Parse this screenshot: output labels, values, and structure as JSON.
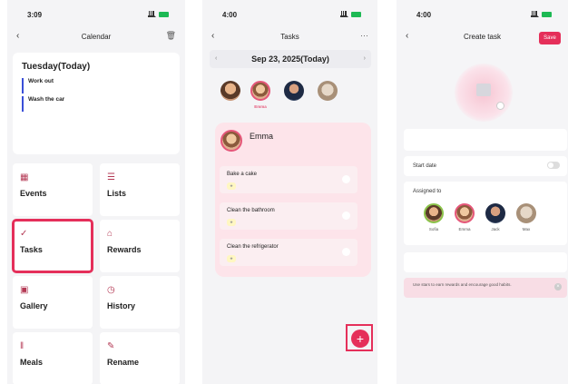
{
  "screen1": {
    "status_time": "3:09",
    "nav_title": "Calendar",
    "today_header": "Tuesday(Today)",
    "events": [
      {
        "title": "Work out"
      },
      {
        "title": "Wash the car"
      }
    ],
    "tiles": [
      {
        "label": "Events"
      },
      {
        "label": "Lists"
      },
      {
        "label": "Tasks"
      },
      {
        "label": "Rewards"
      },
      {
        "label": "Gallery"
      },
      {
        "label": "History"
      },
      {
        "label": "Meals"
      },
      {
        "label": "Rename"
      }
    ]
  },
  "screen2": {
    "status_time": "4:00",
    "nav_title": "Tasks",
    "nav_more": "···",
    "date_label": "Sep 23, 2025(Today)",
    "selected_member": "Emma",
    "tasks": [
      {
        "title": "Bake a cake"
      },
      {
        "title": "Clean the bathroom"
      },
      {
        "title": "Clean the refrigerator"
      }
    ],
    "fab_symbol": "+"
  },
  "screen3": {
    "status_time": "4:00",
    "nav_title": "Create task",
    "save_label": "Save",
    "start_date_label": "Start date",
    "assigned_to_label": "Assigned to",
    "members": [
      "Sofia",
      "Emma",
      "Jack",
      "Max"
    ],
    "hint_text": "Use stars to earn rewards and encourage good habits."
  },
  "colors": {
    "accent": "#e52f5a",
    "event_bar": "#3a4fd8",
    "pink_card": "#fde4ea"
  }
}
